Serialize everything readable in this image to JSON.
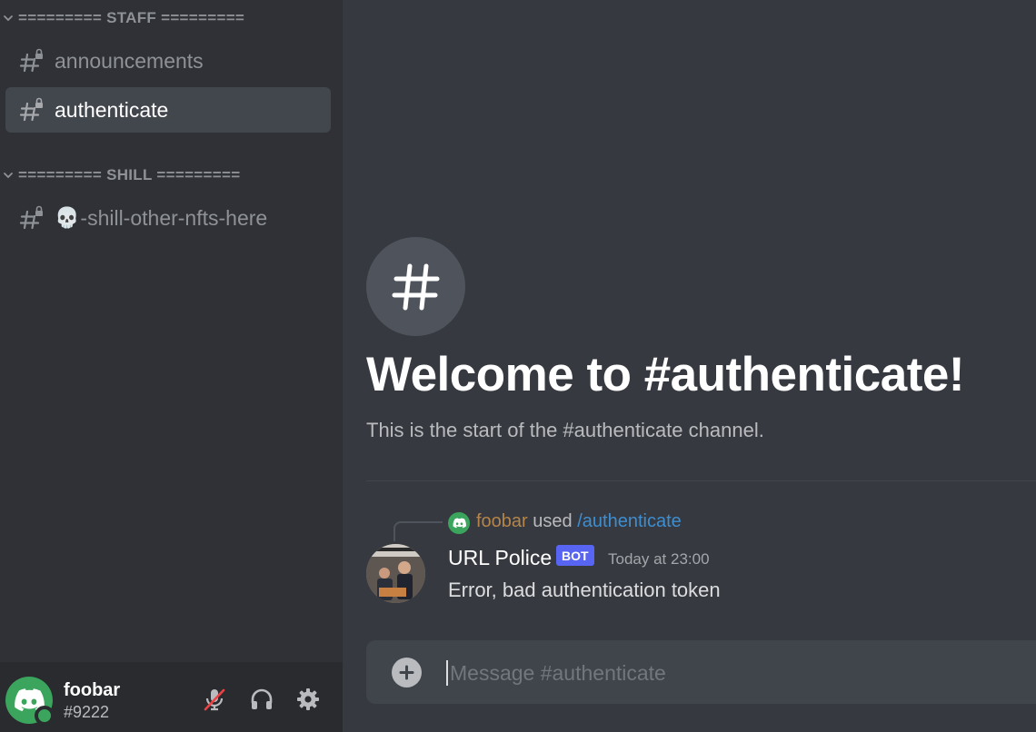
{
  "sidebar": {
    "categories": [
      {
        "label": "========= STAFF ========="
      },
      {
        "label": "========= SHILL ========="
      }
    ],
    "channels": [
      {
        "name": "announcements",
        "locked": true,
        "active": false
      },
      {
        "name": "authenticate",
        "locked": true,
        "active": true
      },
      {
        "emoji": "💀",
        "name": "-shill-other-nfts-here",
        "locked": true,
        "active": false
      }
    ]
  },
  "user_panel": {
    "username": "foobar",
    "discriminator": "#9222",
    "status": "online",
    "controls": [
      "mute-icon",
      "headphones-icon",
      "gear-icon"
    ]
  },
  "main": {
    "welcome_title": "Welcome to #authenticate!",
    "welcome_subtitle": "This is the start of the #authenticate channel.",
    "message": {
      "reply_user": "foobar",
      "reply_used": "used",
      "reply_command": "/authenticate",
      "author": "URL Police",
      "bot_tag": "BOT",
      "timestamp": "Today at 23:00",
      "content": "Error, bad authentication token"
    },
    "composer_placeholder": "Message #authenticate"
  },
  "colors": {
    "sidebar_bg": "#2f3136",
    "main_bg": "#36393f",
    "active_channel": "#42464d",
    "online_green": "#3ba55d",
    "bot_tag": "#5865f2",
    "command_link": "#3e8ed0",
    "reply_user": "#b5854a"
  }
}
